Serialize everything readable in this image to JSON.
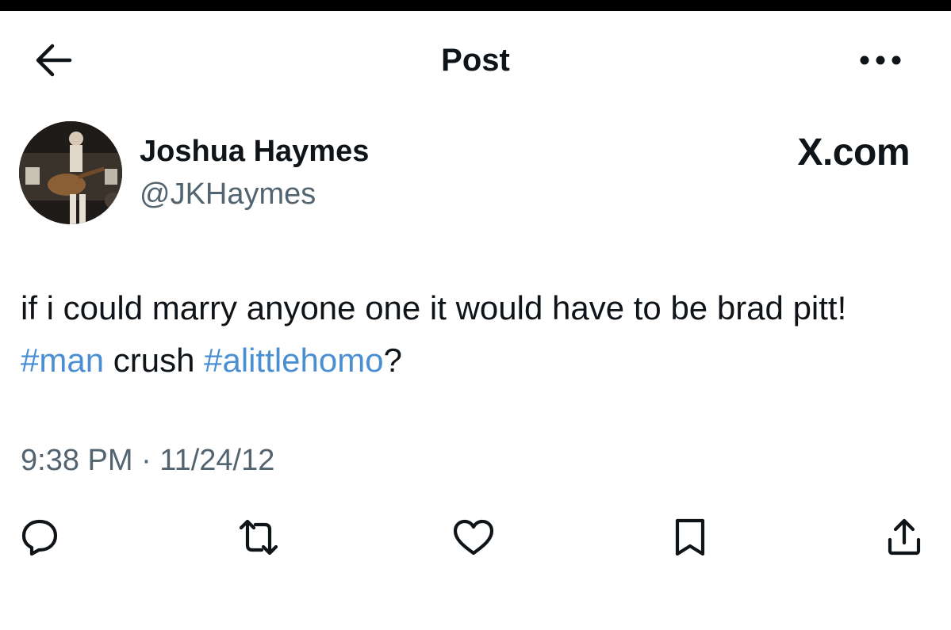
{
  "header": {
    "title": "Post",
    "back_icon": "arrow-left-icon",
    "more_icon": "more-horizontal-icon"
  },
  "author": {
    "display_name": "Joshua Haymes",
    "handle": "@JKHaymes",
    "avatar_icon": "avatar-photo"
  },
  "brand": {
    "label": "X.com"
  },
  "post": {
    "text_1": "if i could marry anyone one it would have to be brad pitt! ",
    "hashtag_1": "#man",
    "text_2": " crush ",
    "hashtag_2": "#alittlehomo",
    "text_3": "?",
    "timestamp": "9:38 PM · 11/24/12"
  },
  "actions": [
    {
      "icon": "reply-icon"
    },
    {
      "icon": "repost-icon"
    },
    {
      "icon": "like-icon"
    },
    {
      "icon": "bookmark-icon"
    },
    {
      "icon": "share-icon"
    }
  ],
  "colors": {
    "text": "#0f1419",
    "secondary": "#536471",
    "link": "#4a8fd4",
    "background": "#ffffff",
    "top_bar": "#000000"
  }
}
